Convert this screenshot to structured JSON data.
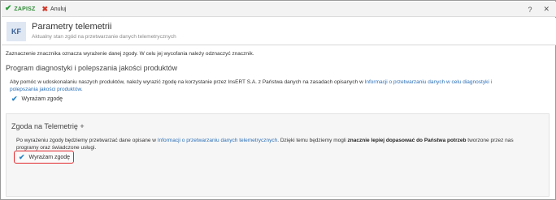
{
  "toolbar": {
    "save_icon": "checkmark-icon",
    "save_label": "ZAPISZ",
    "cancel_icon": "x-icon",
    "cancel_label": "Anuluj",
    "help_label": "?",
    "close_label": "✕"
  },
  "header": {
    "badge": "KF",
    "title": "Parametry telemetrii",
    "subtitle": "Aktualny stan zgód na przetwarzanie danych telemetrycznych"
  },
  "info_text": "Zaznaczenie znacznika oznacza wyrażenie danej zgody. W celu jej wycofania należy odznaczyć znacznik.",
  "section1": {
    "title": "Program diagnostyki i polepszania jakości produktów",
    "text_before_link": "Aby pomóc w udoskonalaniu naszych produktów, należy wyrazić zgodę na korzystanie przez InsERT S.A. z Państwa danych na zasadach opisanych w ",
    "link": "Informacji o przetwarzaniu danych w celu diagnostyki i polepszania jakości produktów",
    "text_after_link": ".",
    "checkbox_label": "Wyrażam zgodę",
    "checked": true
  },
  "section2": {
    "title": "Zgoda na Telemetrię +",
    "text_before_link": "Po wyrażeniu zgody będziemy przetwarzać dane opisane w ",
    "link": "Informacji o przetwarzaniu danych telemetrycznych",
    "text_middle": ". Dzięki temu będziemy mogli ",
    "bold": "znacznie lepiej dopasować do Państwa potrzeb",
    "text_after_bold": " tworzone przez nas programy oraz świadczone usługi.",
    "checkbox_label": "Wyrażam zgodę",
    "checked": true,
    "highlight_color": "#e2262b"
  },
  "colors": {
    "accent_green": "#2e9a3a",
    "cancel_red": "#d23a2a",
    "link_blue": "#2a6fb7",
    "check_blue": "#2a84c8"
  }
}
